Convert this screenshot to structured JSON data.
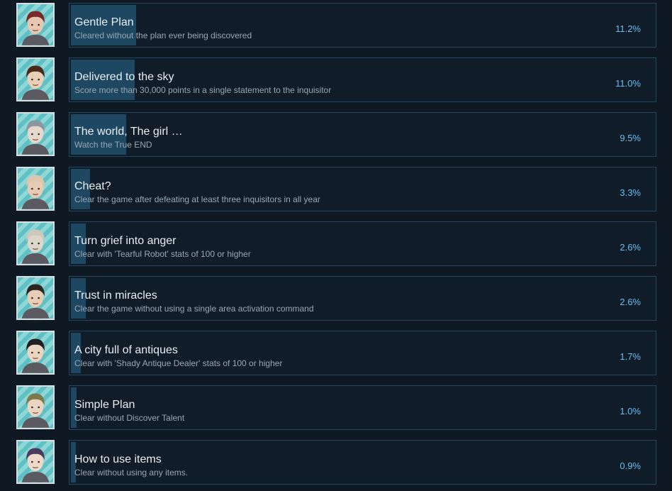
{
  "achievements": [
    {
      "title": "Gentle Plan",
      "description": "Cleared without the plan ever being discovered",
      "percent_label": "11.2%",
      "percent": 11.2,
      "avatar": "red-haired-character-portrait",
      "hair": "#7a2a2a",
      "skin": "#e8c6b0"
    },
    {
      "title": "Delivered to the sky",
      "description": "Score more than 30,000 points in a single statement to the inquisitor",
      "percent_label": "11.0%",
      "percent": 11.0,
      "avatar": "brown-haired-man-portrait",
      "hair": "#4a2a18",
      "skin": "#e9cfb6"
    },
    {
      "title": "The world, The girl …",
      "description": "Watch the True END",
      "percent_label": "9.5%",
      "percent": 9.5,
      "avatar": "grey-haired-man-portrait",
      "hair": "#8a96a0",
      "skin": "#e6d7cc"
    },
    {
      "title": "Cheat?",
      "description": "Clear the game after defeating at least three inquisitors in all year",
      "percent_label": "3.3%",
      "percent": 3.3,
      "avatar": "bald-old-man-portrait",
      "hair": "#d9c7b2",
      "skin": "#e8cbb0"
    },
    {
      "title": "Turn grief into anger",
      "description": "Clear with 'Tearful Robot' stats of 100 or higher",
      "percent_label": "2.6%",
      "percent": 2.6,
      "avatar": "robot-portrait",
      "hair": "#cfc7ba",
      "skin": "#ddd6ca"
    },
    {
      "title": "Trust in miracles",
      "description": "Clear the game without using a single area activation command",
      "percent_label": "2.6%",
      "percent": 2.6,
      "avatar": "dark-haired-man-portrait",
      "hair": "#2a2624",
      "skin": "#e7cdb6"
    },
    {
      "title": "A city full of antiques",
      "description": "Clear with 'Shady Antique Dealer' stats of 100 or higher",
      "percent_label": "1.7%",
      "percent": 1.7,
      "avatar": "glasses-man-portrait",
      "hair": "#1f1f22",
      "skin": "#ecd5c0"
    },
    {
      "title": "Simple Plan",
      "description": "Clear without Discover Talent",
      "percent_label": "1.0%",
      "percent": 1.0,
      "avatar": "hat-wearing-character-portrait",
      "hair": "#7b7a4a",
      "skin": "#ecd5c0"
    },
    {
      "title": "How to use items",
      "description": "Clear without using any items.",
      "percent_label": "0.9%",
      "percent": 0.9,
      "avatar": "purple-haired-woman-portrait",
      "hair": "#4b3b5e",
      "skin": "#efd9c8"
    }
  ]
}
